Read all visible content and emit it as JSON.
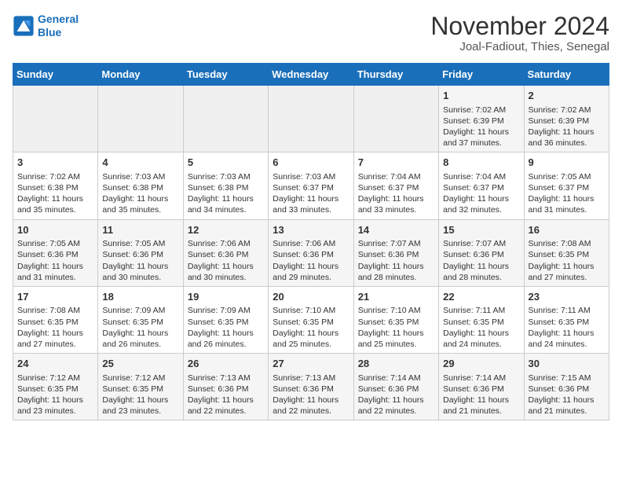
{
  "header": {
    "logo_line1": "General",
    "logo_line2": "Blue",
    "title": "November 2024",
    "subtitle": "Joal-Fadiout, Thies, Senegal"
  },
  "weekdays": [
    "Sunday",
    "Monday",
    "Tuesday",
    "Wednesday",
    "Thursday",
    "Friday",
    "Saturday"
  ],
  "weeks": [
    [
      {
        "day": "",
        "info": ""
      },
      {
        "day": "",
        "info": ""
      },
      {
        "day": "",
        "info": ""
      },
      {
        "day": "",
        "info": ""
      },
      {
        "day": "",
        "info": ""
      },
      {
        "day": "1",
        "info": "Sunrise: 7:02 AM\nSunset: 6:39 PM\nDaylight: 11 hours\nand 37 minutes."
      },
      {
        "day": "2",
        "info": "Sunrise: 7:02 AM\nSunset: 6:39 PM\nDaylight: 11 hours\nand 36 minutes."
      }
    ],
    [
      {
        "day": "3",
        "info": "Sunrise: 7:02 AM\nSunset: 6:38 PM\nDaylight: 11 hours\nand 35 minutes."
      },
      {
        "day": "4",
        "info": "Sunrise: 7:03 AM\nSunset: 6:38 PM\nDaylight: 11 hours\nand 35 minutes."
      },
      {
        "day": "5",
        "info": "Sunrise: 7:03 AM\nSunset: 6:38 PM\nDaylight: 11 hours\nand 34 minutes."
      },
      {
        "day": "6",
        "info": "Sunrise: 7:03 AM\nSunset: 6:37 PM\nDaylight: 11 hours\nand 33 minutes."
      },
      {
        "day": "7",
        "info": "Sunrise: 7:04 AM\nSunset: 6:37 PM\nDaylight: 11 hours\nand 33 minutes."
      },
      {
        "day": "8",
        "info": "Sunrise: 7:04 AM\nSunset: 6:37 PM\nDaylight: 11 hours\nand 32 minutes."
      },
      {
        "day": "9",
        "info": "Sunrise: 7:05 AM\nSunset: 6:37 PM\nDaylight: 11 hours\nand 31 minutes."
      }
    ],
    [
      {
        "day": "10",
        "info": "Sunrise: 7:05 AM\nSunset: 6:36 PM\nDaylight: 11 hours\nand 31 minutes."
      },
      {
        "day": "11",
        "info": "Sunrise: 7:05 AM\nSunset: 6:36 PM\nDaylight: 11 hours\nand 30 minutes."
      },
      {
        "day": "12",
        "info": "Sunrise: 7:06 AM\nSunset: 6:36 PM\nDaylight: 11 hours\nand 30 minutes."
      },
      {
        "day": "13",
        "info": "Sunrise: 7:06 AM\nSunset: 6:36 PM\nDaylight: 11 hours\nand 29 minutes."
      },
      {
        "day": "14",
        "info": "Sunrise: 7:07 AM\nSunset: 6:36 PM\nDaylight: 11 hours\nand 28 minutes."
      },
      {
        "day": "15",
        "info": "Sunrise: 7:07 AM\nSunset: 6:36 PM\nDaylight: 11 hours\nand 28 minutes."
      },
      {
        "day": "16",
        "info": "Sunrise: 7:08 AM\nSunset: 6:35 PM\nDaylight: 11 hours\nand 27 minutes."
      }
    ],
    [
      {
        "day": "17",
        "info": "Sunrise: 7:08 AM\nSunset: 6:35 PM\nDaylight: 11 hours\nand 27 minutes."
      },
      {
        "day": "18",
        "info": "Sunrise: 7:09 AM\nSunset: 6:35 PM\nDaylight: 11 hours\nand 26 minutes."
      },
      {
        "day": "19",
        "info": "Sunrise: 7:09 AM\nSunset: 6:35 PM\nDaylight: 11 hours\nand 26 minutes."
      },
      {
        "day": "20",
        "info": "Sunrise: 7:10 AM\nSunset: 6:35 PM\nDaylight: 11 hours\nand 25 minutes."
      },
      {
        "day": "21",
        "info": "Sunrise: 7:10 AM\nSunset: 6:35 PM\nDaylight: 11 hours\nand 25 minutes."
      },
      {
        "day": "22",
        "info": "Sunrise: 7:11 AM\nSunset: 6:35 PM\nDaylight: 11 hours\nand 24 minutes."
      },
      {
        "day": "23",
        "info": "Sunrise: 7:11 AM\nSunset: 6:35 PM\nDaylight: 11 hours\nand 24 minutes."
      }
    ],
    [
      {
        "day": "24",
        "info": "Sunrise: 7:12 AM\nSunset: 6:35 PM\nDaylight: 11 hours\nand 23 minutes."
      },
      {
        "day": "25",
        "info": "Sunrise: 7:12 AM\nSunset: 6:35 PM\nDaylight: 11 hours\nand 23 minutes."
      },
      {
        "day": "26",
        "info": "Sunrise: 7:13 AM\nSunset: 6:36 PM\nDaylight: 11 hours\nand 22 minutes."
      },
      {
        "day": "27",
        "info": "Sunrise: 7:13 AM\nSunset: 6:36 PM\nDaylight: 11 hours\nand 22 minutes."
      },
      {
        "day": "28",
        "info": "Sunrise: 7:14 AM\nSunset: 6:36 PM\nDaylight: 11 hours\nand 22 minutes."
      },
      {
        "day": "29",
        "info": "Sunrise: 7:14 AM\nSunset: 6:36 PM\nDaylight: 11 hours\nand 21 minutes."
      },
      {
        "day": "30",
        "info": "Sunrise: 7:15 AM\nSunset: 6:36 PM\nDaylight: 11 hours\nand 21 minutes."
      }
    ]
  ]
}
